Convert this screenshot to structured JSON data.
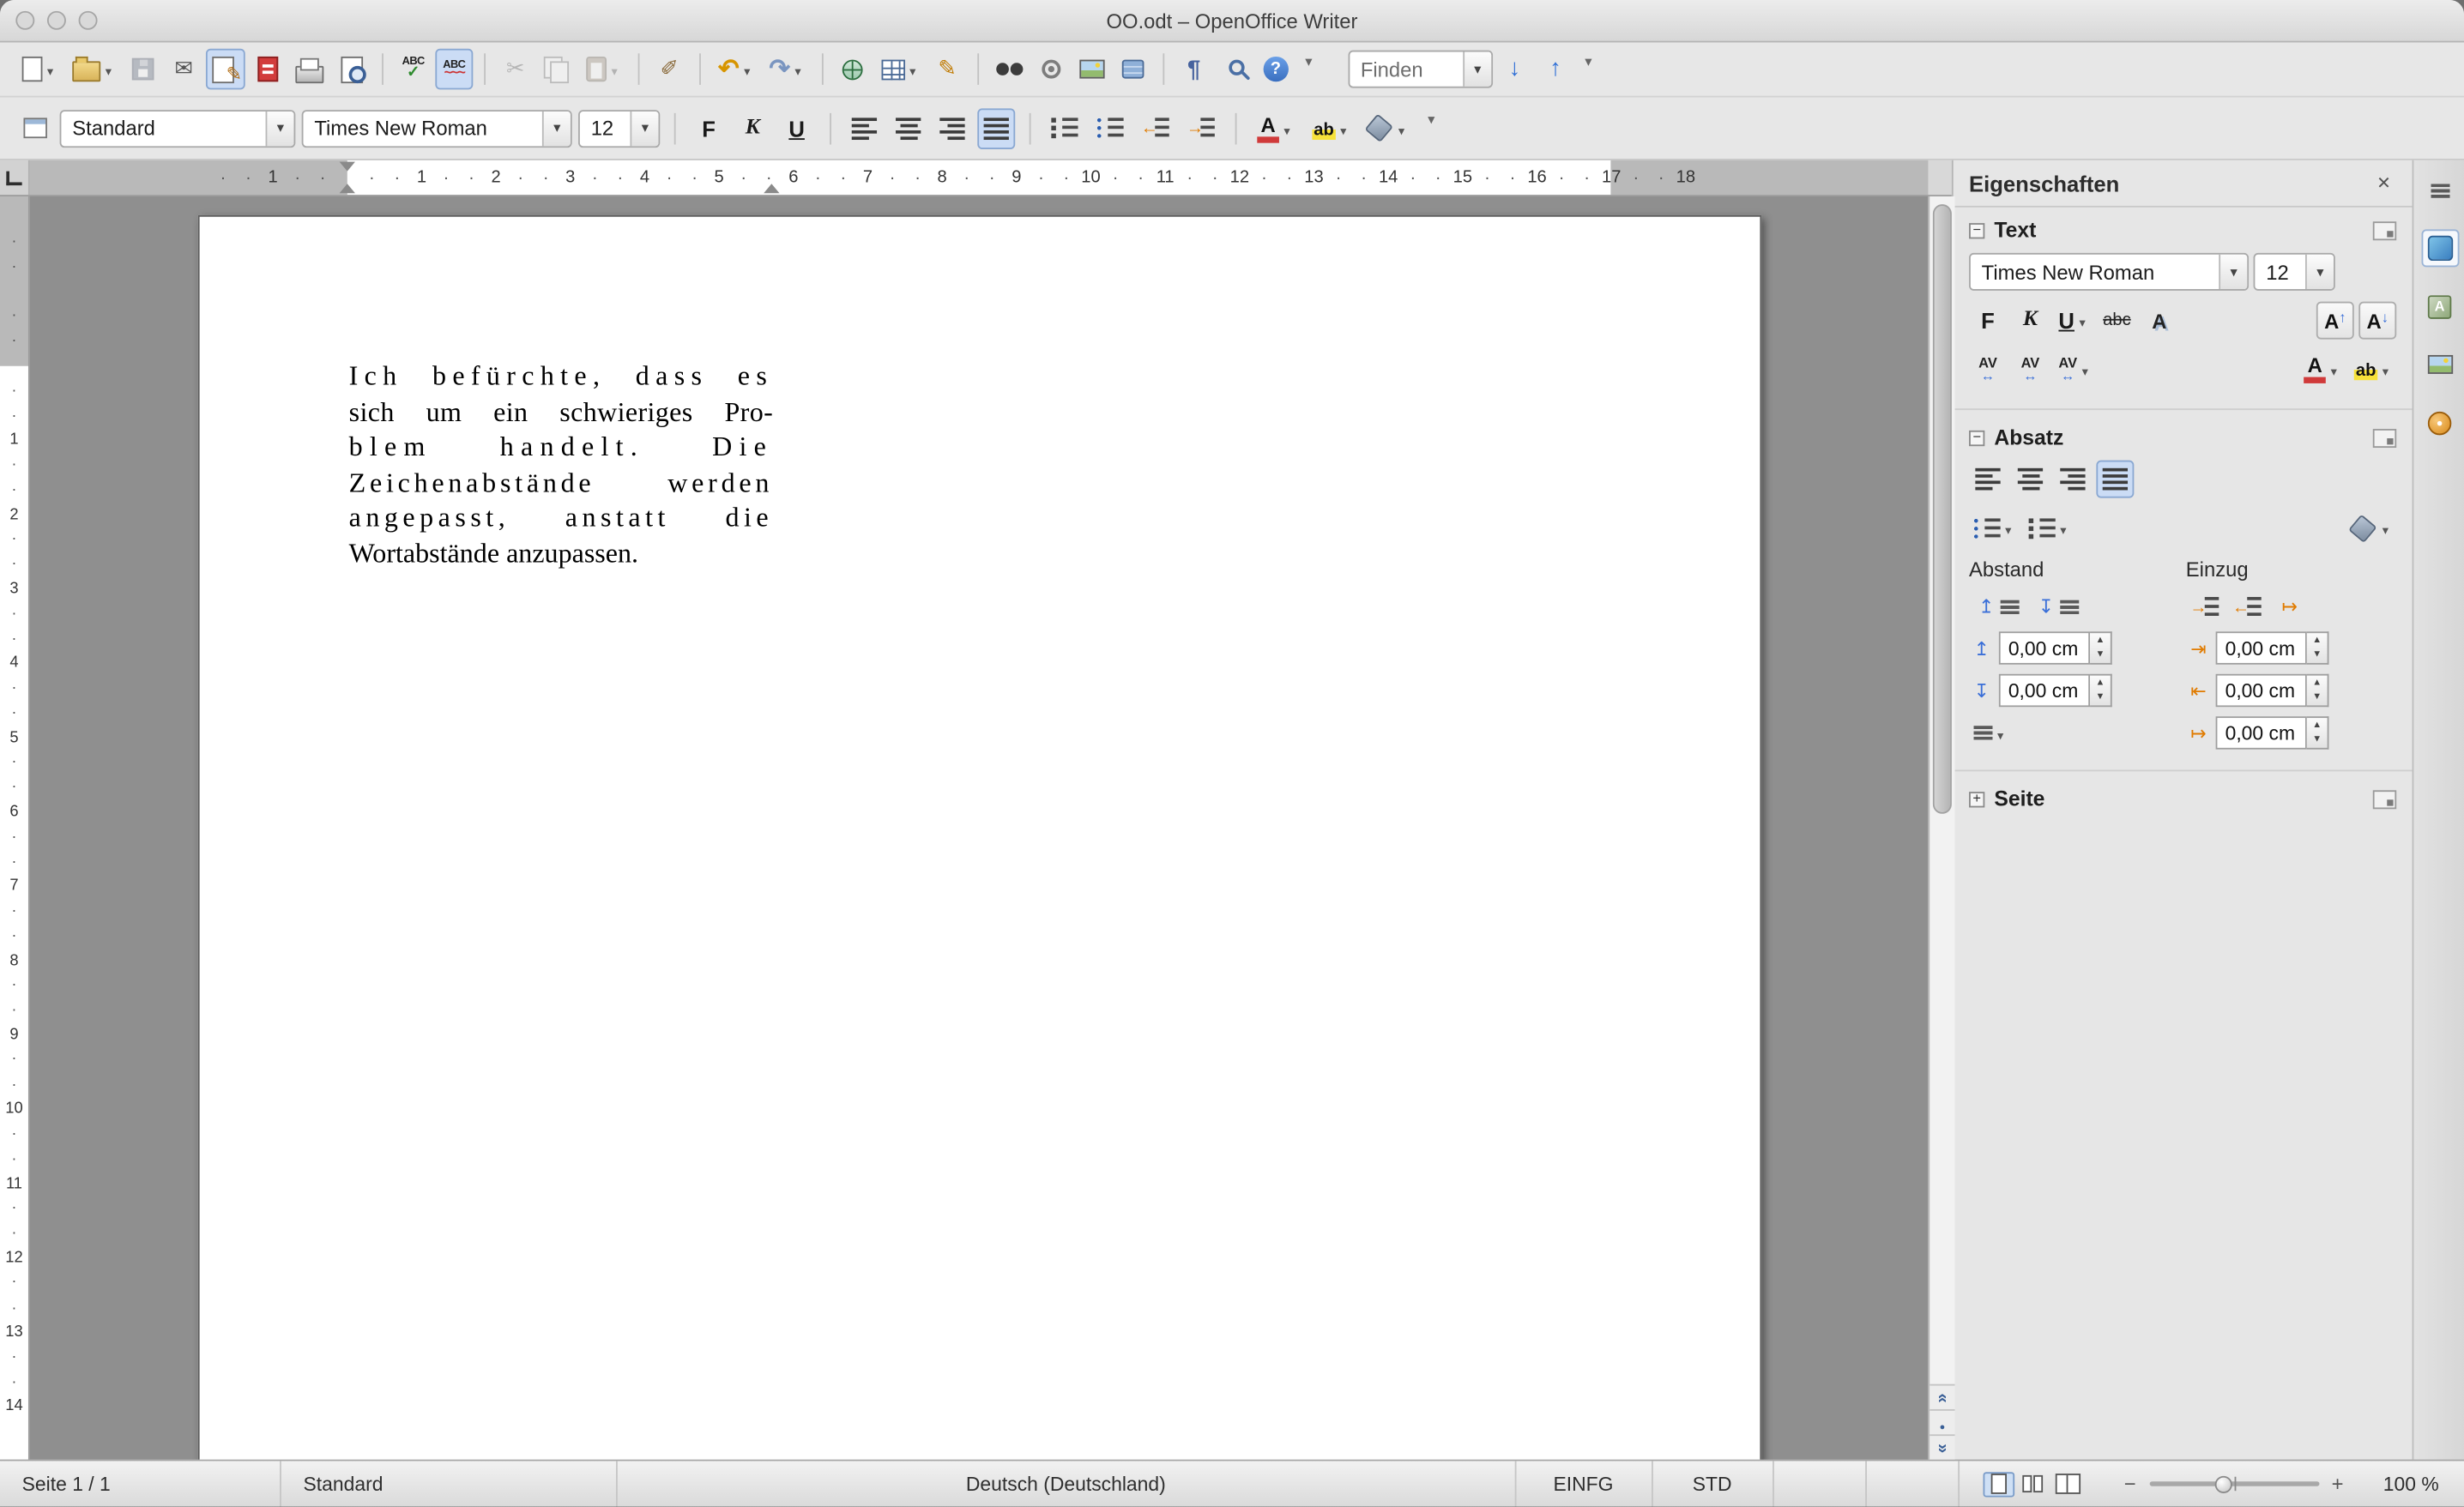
{
  "window": {
    "title": "OO.odt – OpenOffice Writer"
  },
  "toolbars": {
    "find_value": "Finden"
  },
  "format": {
    "paragraph_style": "Standard",
    "font_name": "Times New Roman",
    "font_size": "12"
  },
  "icons": {
    "bold": "F",
    "italic": "K",
    "underline": "U",
    "spellcheck": "ABC",
    "autospellcheck": "ABC",
    "strikethrough": "abc",
    "shadow": "A",
    "font_color": "A",
    "highlight": "ab",
    "char_spacing": "AV",
    "grow_font": "A",
    "shrink_font": "A",
    "help": "?",
    "paragraph_mark": "¶"
  },
  "ruler": {
    "h_negative": "1",
    "h_numbers": [
      "1",
      "2",
      "3",
      "4",
      "5",
      "6",
      "7",
      "8",
      "9",
      "10",
      "11",
      "12",
      "13",
      "14",
      "15",
      "16",
      "17",
      "18"
    ],
    "v_numbers": [
      "1",
      "2",
      "3",
      "4",
      "5",
      "6",
      "7",
      "8",
      "9",
      "10",
      "11",
      "12",
      "13",
      "14"
    ]
  },
  "document": {
    "lines": [
      "Ich befürchte, dass es",
      "sich um ein schwieriges Pro-",
      "blem handelt. Die",
      "Zeichenabstände werden",
      "angepasst, anstatt die",
      "Wortabstände anzupassen."
    ]
  },
  "sidebar": {
    "title": "Eigenschaften",
    "text_section": {
      "label": "Text",
      "font_name": "Times New Roman",
      "font_size": "12"
    },
    "paragraph_section": {
      "label": "Absatz",
      "spacing_label": "Abstand",
      "indent_label": "Einzug",
      "above_spacing": "0,00 cm",
      "below_spacing": "0,00 cm",
      "before_indent": "0,00 cm",
      "after_indent": "0,00 cm",
      "first_line_indent": "0,00 cm"
    },
    "page_section": {
      "label": "Seite"
    }
  },
  "statusbar": {
    "page": "Seite 1 / 1",
    "style": "Standard",
    "language": "Deutsch (Deutschland)",
    "insert_mode": "EINFG",
    "selection_mode": "STD",
    "zoom": "100 %"
  }
}
